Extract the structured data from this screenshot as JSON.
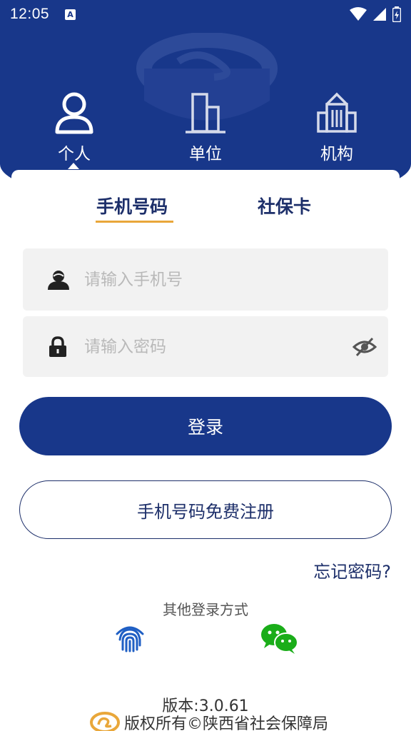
{
  "status_bar": {
    "time": "12:05",
    "notification_icon": "A",
    "icons": [
      "wifi-icon",
      "signal-icon",
      "battery-icon"
    ]
  },
  "user_type_tabs": [
    {
      "label": "个人",
      "icon": "person-icon",
      "selected": true
    },
    {
      "label": "单位",
      "icon": "building-icon",
      "selected": false
    },
    {
      "label": "机构",
      "icon": "institution-icon",
      "selected": false
    }
  ],
  "login_tabs": [
    {
      "label": "手机号码",
      "selected": true
    },
    {
      "label": "社保卡",
      "selected": false
    }
  ],
  "phone_input": {
    "placeholder": "请输入手机号",
    "value": ""
  },
  "password_input": {
    "placeholder": "请输入密码",
    "value": ""
  },
  "buttons": {
    "login": "登录",
    "register": "手机号码免费注册",
    "forgot_password": "忘记密码?"
  },
  "other_login": {
    "title": "其他登录方式",
    "methods": [
      "fingerprint-icon",
      "wechat-icon"
    ]
  },
  "footer": {
    "version": "版本:3.0.61",
    "copyright": "版权所有©陕西省社会保障局"
  },
  "colors": {
    "brand_blue": "#18378a",
    "text_dark_blue": "#1d2f6a",
    "tab_underline": "#e9a73a",
    "wechat_green": "#1aad19",
    "fingerprint_blue": "#1f5fc4"
  }
}
